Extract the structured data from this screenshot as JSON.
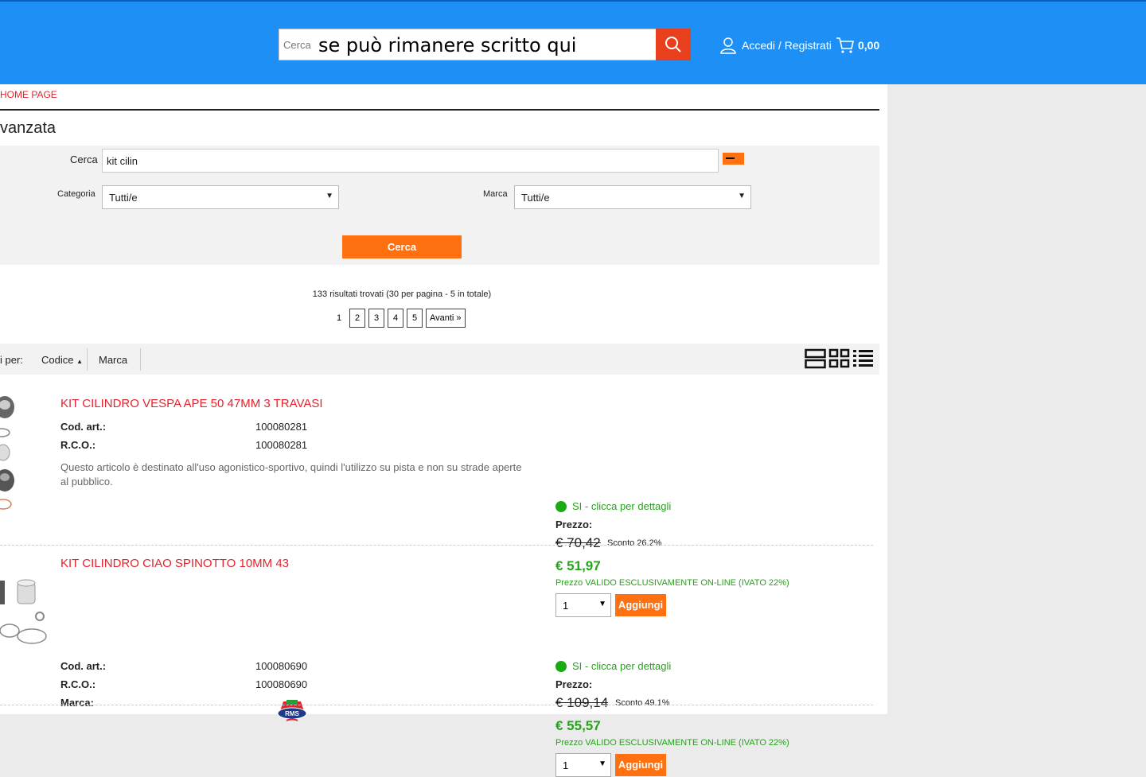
{
  "header": {
    "search_placeholder": "Cerca",
    "search_typed": "se può rimanere scritto qui",
    "account_label": "Accedi / Registrati",
    "cart_total": "0,00"
  },
  "breadcrumb": "HOME PAGE",
  "page_title": "vanzata",
  "filters": {
    "search_label": "Cerca",
    "search_value": "kit cilin",
    "category_label": "Categoria",
    "category_value": "Tutti/e",
    "brand_label": "Marca",
    "brand_value": "Tutti/e",
    "submit_label": "Cerca"
  },
  "results": {
    "summary": "133 risultati trovati (30 per pagina - 5 in totale)",
    "current_page": "1",
    "pages": [
      "2",
      "3",
      "4",
      "5"
    ],
    "next_label": "Avanti »"
  },
  "sort": {
    "label": "i per:",
    "options": [
      "Codice",
      "Marca"
    ]
  },
  "products": [
    {
      "title": "KIT CILINDRO VESPA APE 50 47MM 3 TRAVASI",
      "code_label": "Cod. art.:",
      "code": "100080281",
      "rco_label": "R.C.O.:",
      "rco": "100080281",
      "description": "Questo articolo è destinato all'uso agonistico-sportivo, quindi l'utilizzo su pista e non su strade aperte al pubblico.",
      "availability": "SI - clicca per dettagli",
      "price_label": "Prezzo:",
      "old_price": "€ 70,42",
      "discount": "Sconto 26.2%",
      "price": "€ 51,97",
      "note": "Prezzo VALIDO ESCLUSIVAMENTE ON-LINE (IVATO 22%)",
      "qty": "1",
      "add_label": "Aggiungi"
    },
    {
      "title": "KIT CILINDRO CIAO SPINOTTO 10MM 43",
      "code_label": "Cod. art.:",
      "code": "100080690",
      "rco_label": "R.C.O.:",
      "rco": "100080690",
      "brand_label": "Marca:",
      "brand_logo_text": "RMS",
      "availability": "SI - clicca per dettagli",
      "price_label": "Prezzo:",
      "old_price": "€ 109,14",
      "discount": "Sconto 49.1%",
      "price": "€ 55,57",
      "note": "Prezzo VALIDO ESCLUSIVAMENTE ON-LINE (IVATO 22%)",
      "qty": "1",
      "add_label": "Aggiungi"
    }
  ]
}
